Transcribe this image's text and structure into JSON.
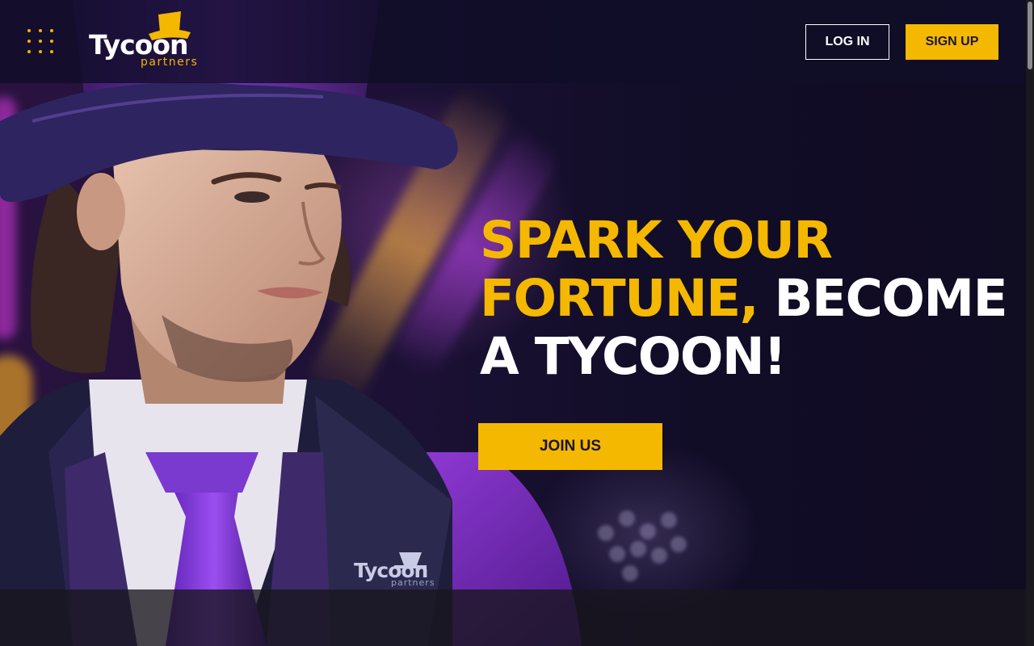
{
  "header": {
    "logo": {
      "word": "Tycoon",
      "sub": "partners"
    },
    "login_label": "LOG IN",
    "signup_label": "SIGN UP"
  },
  "hero": {
    "headline": {
      "line1": "SPARK YOUR",
      "line2_accent": "FORTUNE,",
      "line2_rest": " BECOME",
      "line3": "A TYCOON!"
    },
    "cta_label": "JOIN US",
    "badge_logo": {
      "word": "Tycoon",
      "sub": "partners"
    }
  },
  "colors": {
    "accent": "#f5b800",
    "background": "#100c24",
    "text_light": "#ffffff",
    "purple": "#8a2be2"
  },
  "icons": [
    "menu-dots-icon",
    "top-hat-icon"
  ]
}
